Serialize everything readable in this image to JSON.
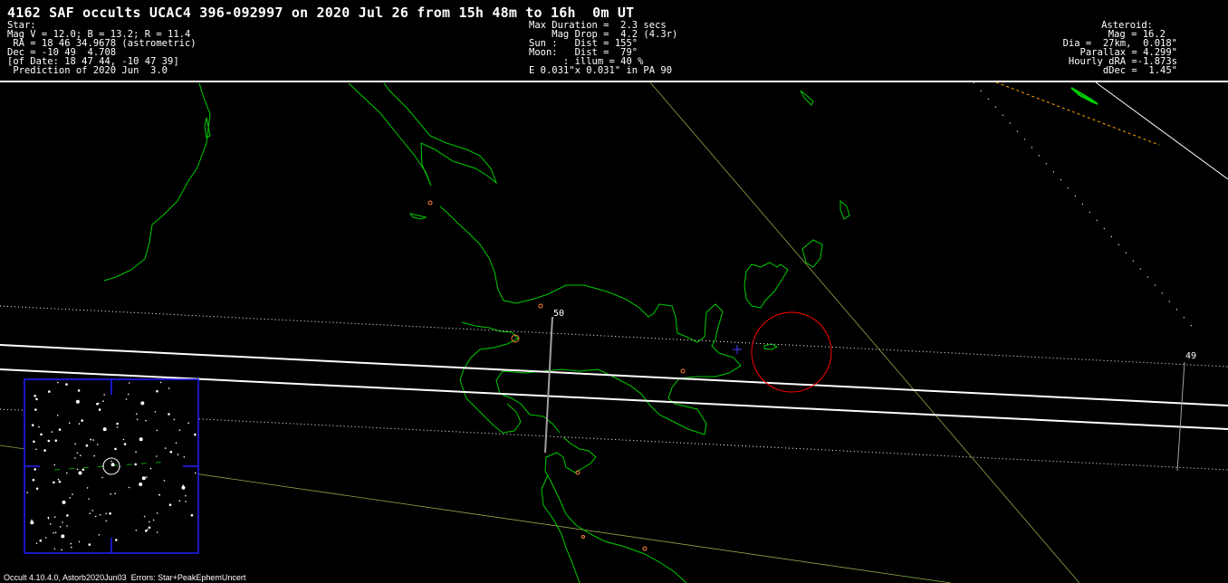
{
  "title": "4162 SAF occults UCAC4 396-092997 on 2020 Jul 26 from 15h 48m to 16h  0m UT",
  "star_block": {
    "heading": "Star:",
    "mags": "Mag V = 12.0; B = 13.2; R = 11.4",
    "ra": " RA = 18 46 34.9678 (astrometric)",
    "dec": "Dec = -10 49  4.708",
    "of_date": "[of Date: 18 47 44, -10 47 39]",
    "prediction": " Prediction of 2020 Jun  3.0"
  },
  "event_block": {
    "max_duration": "Max Duration =  2.3 secs",
    "mag_drop": "    Mag Drop =  4.2 (4.3r)",
    "sun": "Sun :   Dist = 155°",
    "moon": "Moon:   Dist =  79°",
    "illum": "      : illum = 40 %",
    "ellipse": "E 0.031\"x 0.031\" in PA 90"
  },
  "asteroid_block": {
    "heading": "Asteroid:",
    "mag": "Mag = 16.2",
    "dia": "Dia =  27km,  0.018\"",
    "parallax": "Parallax = 4.299\"",
    "hourly_dra": "Hourly dRA =-1.873s",
    "ddec": "dDec =  1.45\""
  },
  "map": {
    "time_ticks": [
      "50",
      "49"
    ],
    "colors": {
      "background": "#000000",
      "text": "#ffffff",
      "coastline": "#00cc00",
      "path_line": "#ffffff",
      "error_dots": "#ffffff",
      "grid_line": "#88aa44",
      "tick_line": "#a0a0a0",
      "site_marker": "#ff8040",
      "red_circle": "#ff0000",
      "center_cross": "#4040ff",
      "star_chart_border": "#2020ff",
      "sun_dashes": "#ffa500"
    }
  },
  "footer": "Occult 4.10.4.0, Astorb2020Jun03  Errors: Star+PeakEphemUncert"
}
